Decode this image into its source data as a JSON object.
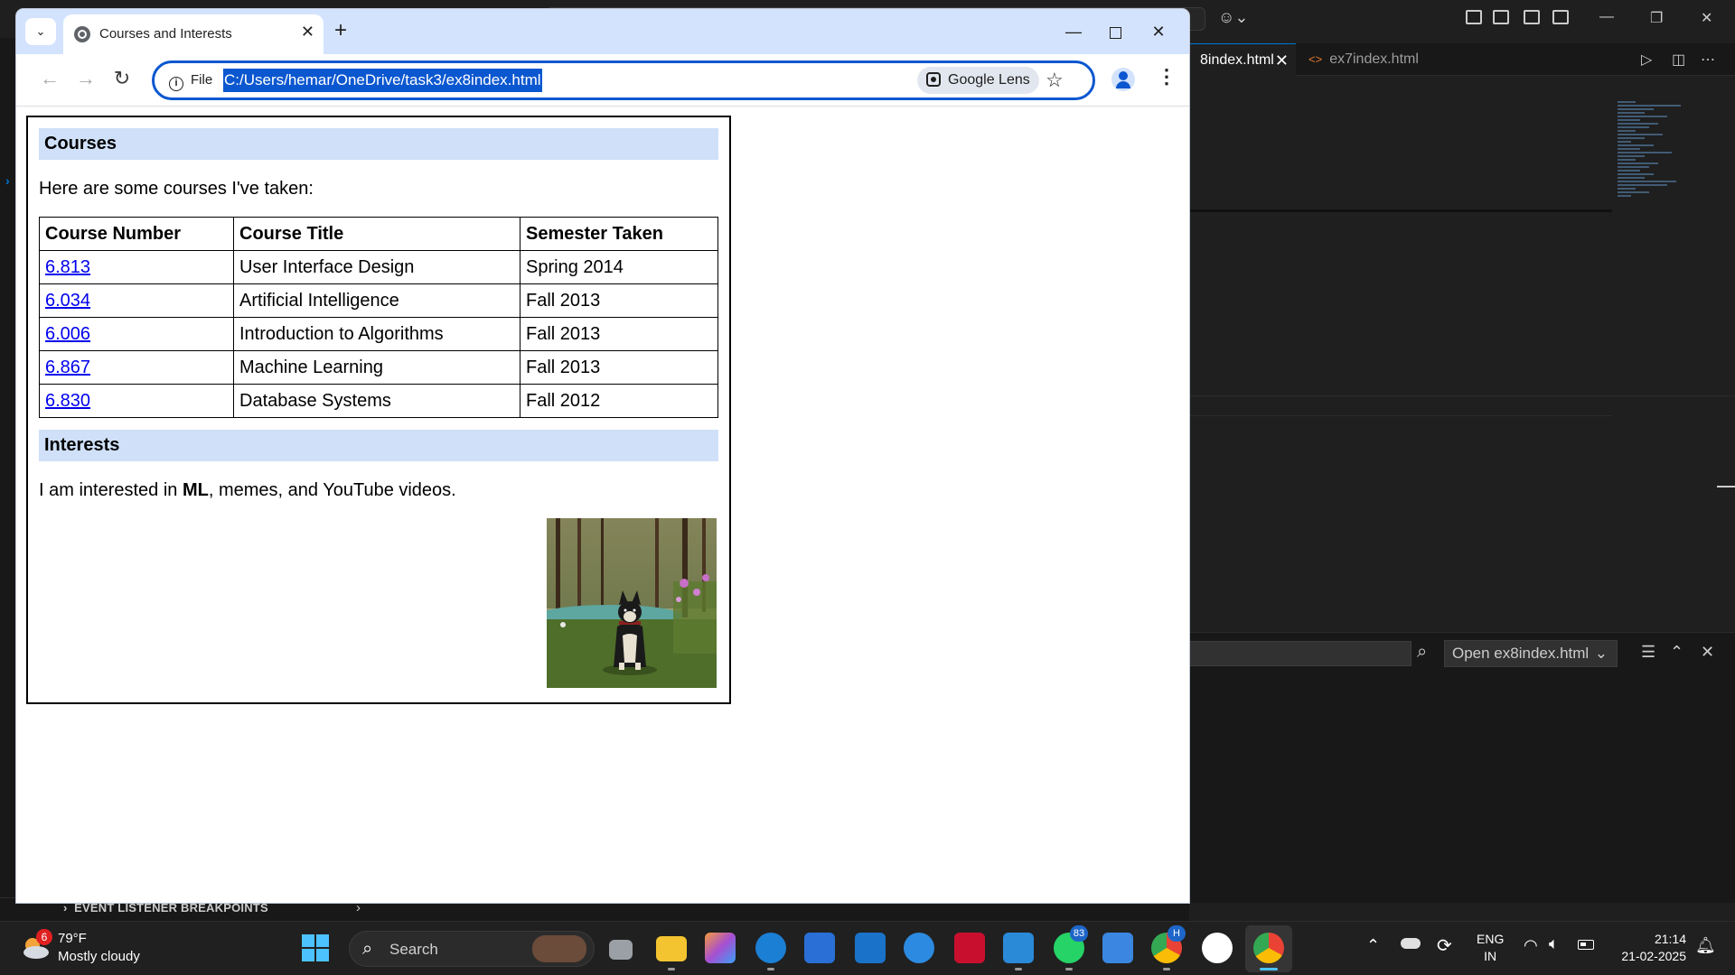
{
  "vscode": {
    "tabs": [
      {
        "label": "8index.html",
        "close": "✕"
      },
      {
        "label": "ex7index.html",
        "icon": "<>"
      }
    ],
    "find_widget": {
      "select_value": "Open ex8index.html"
    },
    "breakpoints_label": "EVENT LISTENER BREAKPOINTS"
  },
  "browser": {
    "tab_title": "Courses and Interests",
    "address": {
      "scheme_label": "File",
      "url": "C:/Users/hemar/OneDrive/task3/ex8index.html"
    },
    "lens_label": "Google Lens",
    "accent_color": "#0b57d0"
  },
  "page": {
    "courses_heading": "Courses",
    "courses_intro": "Here are some courses I've taken:",
    "table": {
      "headers": [
        "Course Number",
        "Course Title",
        "Semester Taken"
      ],
      "rows": [
        {
          "number": "6.813",
          "title": "User Interface Design",
          "semester": "Spring 2014"
        },
        {
          "number": "6.034",
          "title": "Artificial Intelligence",
          "semester": "Fall 2013"
        },
        {
          "number": "6.006",
          "title": "Introduction to Algorithms",
          "semester": "Fall 2013"
        },
        {
          "number": "6.867",
          "title": "Machine Learning",
          "semester": "Fall 2013"
        },
        {
          "number": "6.830",
          "title": "Database Systems",
          "semester": "Fall 2012"
        }
      ]
    },
    "interests_heading": "Interests",
    "interests_prefix": "I am interested in ",
    "interests_bold": "ML",
    "interests_suffix": ", memes, and YouTube videos."
  },
  "taskbar": {
    "weather": {
      "badge": "6",
      "temp": "79°F",
      "desc": "Mostly cloudy"
    },
    "search_placeholder": "Search",
    "badges": {
      "whatsapp": "83",
      "chrome_profile": "H"
    },
    "language": {
      "line1": "ENG",
      "line2": "IN"
    },
    "clock": {
      "time": "21:14",
      "date": "21-02-2025"
    }
  }
}
